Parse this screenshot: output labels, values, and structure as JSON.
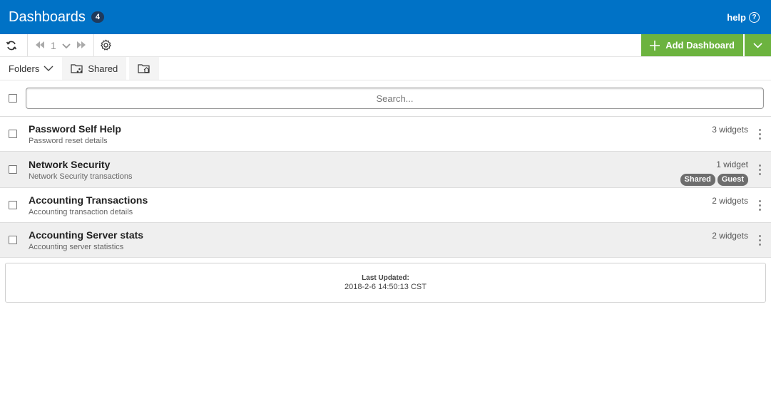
{
  "header": {
    "title": "Dashboards",
    "count": "4",
    "help_label": "help",
    "help_glyph": "?",
    "bg_color": "#0072c6"
  },
  "toolbar": {
    "refresh_icon": "refresh-icon",
    "first_page_icon": "double-left-icon",
    "page_number": "1",
    "page_select_icon": "chevron-down-icon",
    "last_page_icon": "double-right-icon",
    "settings_icon": "gear-icon",
    "add_label": "Add Dashboard",
    "add_color": "#6cb33f"
  },
  "folderbar": {
    "folders_label": "Folders",
    "shared_label": "Shared",
    "shared_icon": "shared-folder-icon",
    "home_icon": "home-folder-icon"
  },
  "search": {
    "placeholder": "Search..."
  },
  "dashboards": [
    {
      "name": "Password Self Help",
      "description": "Password reset details",
      "widgets": "3 widgets",
      "badges": []
    },
    {
      "name": "Network Security",
      "description": "Network Security transactions",
      "widgets": "1 widget",
      "badges": [
        "Shared",
        "Guest"
      ]
    },
    {
      "name": "Accounting Transactions",
      "description": "Accounting transaction details",
      "widgets": "2 widgets",
      "badges": []
    },
    {
      "name": "Accounting Server stats",
      "description": "Accounting server statistics",
      "widgets": "2 widgets",
      "badges": []
    }
  ],
  "footer": {
    "label": "Last Updated:",
    "value": "2018-2-6 14:50:13 CST"
  }
}
